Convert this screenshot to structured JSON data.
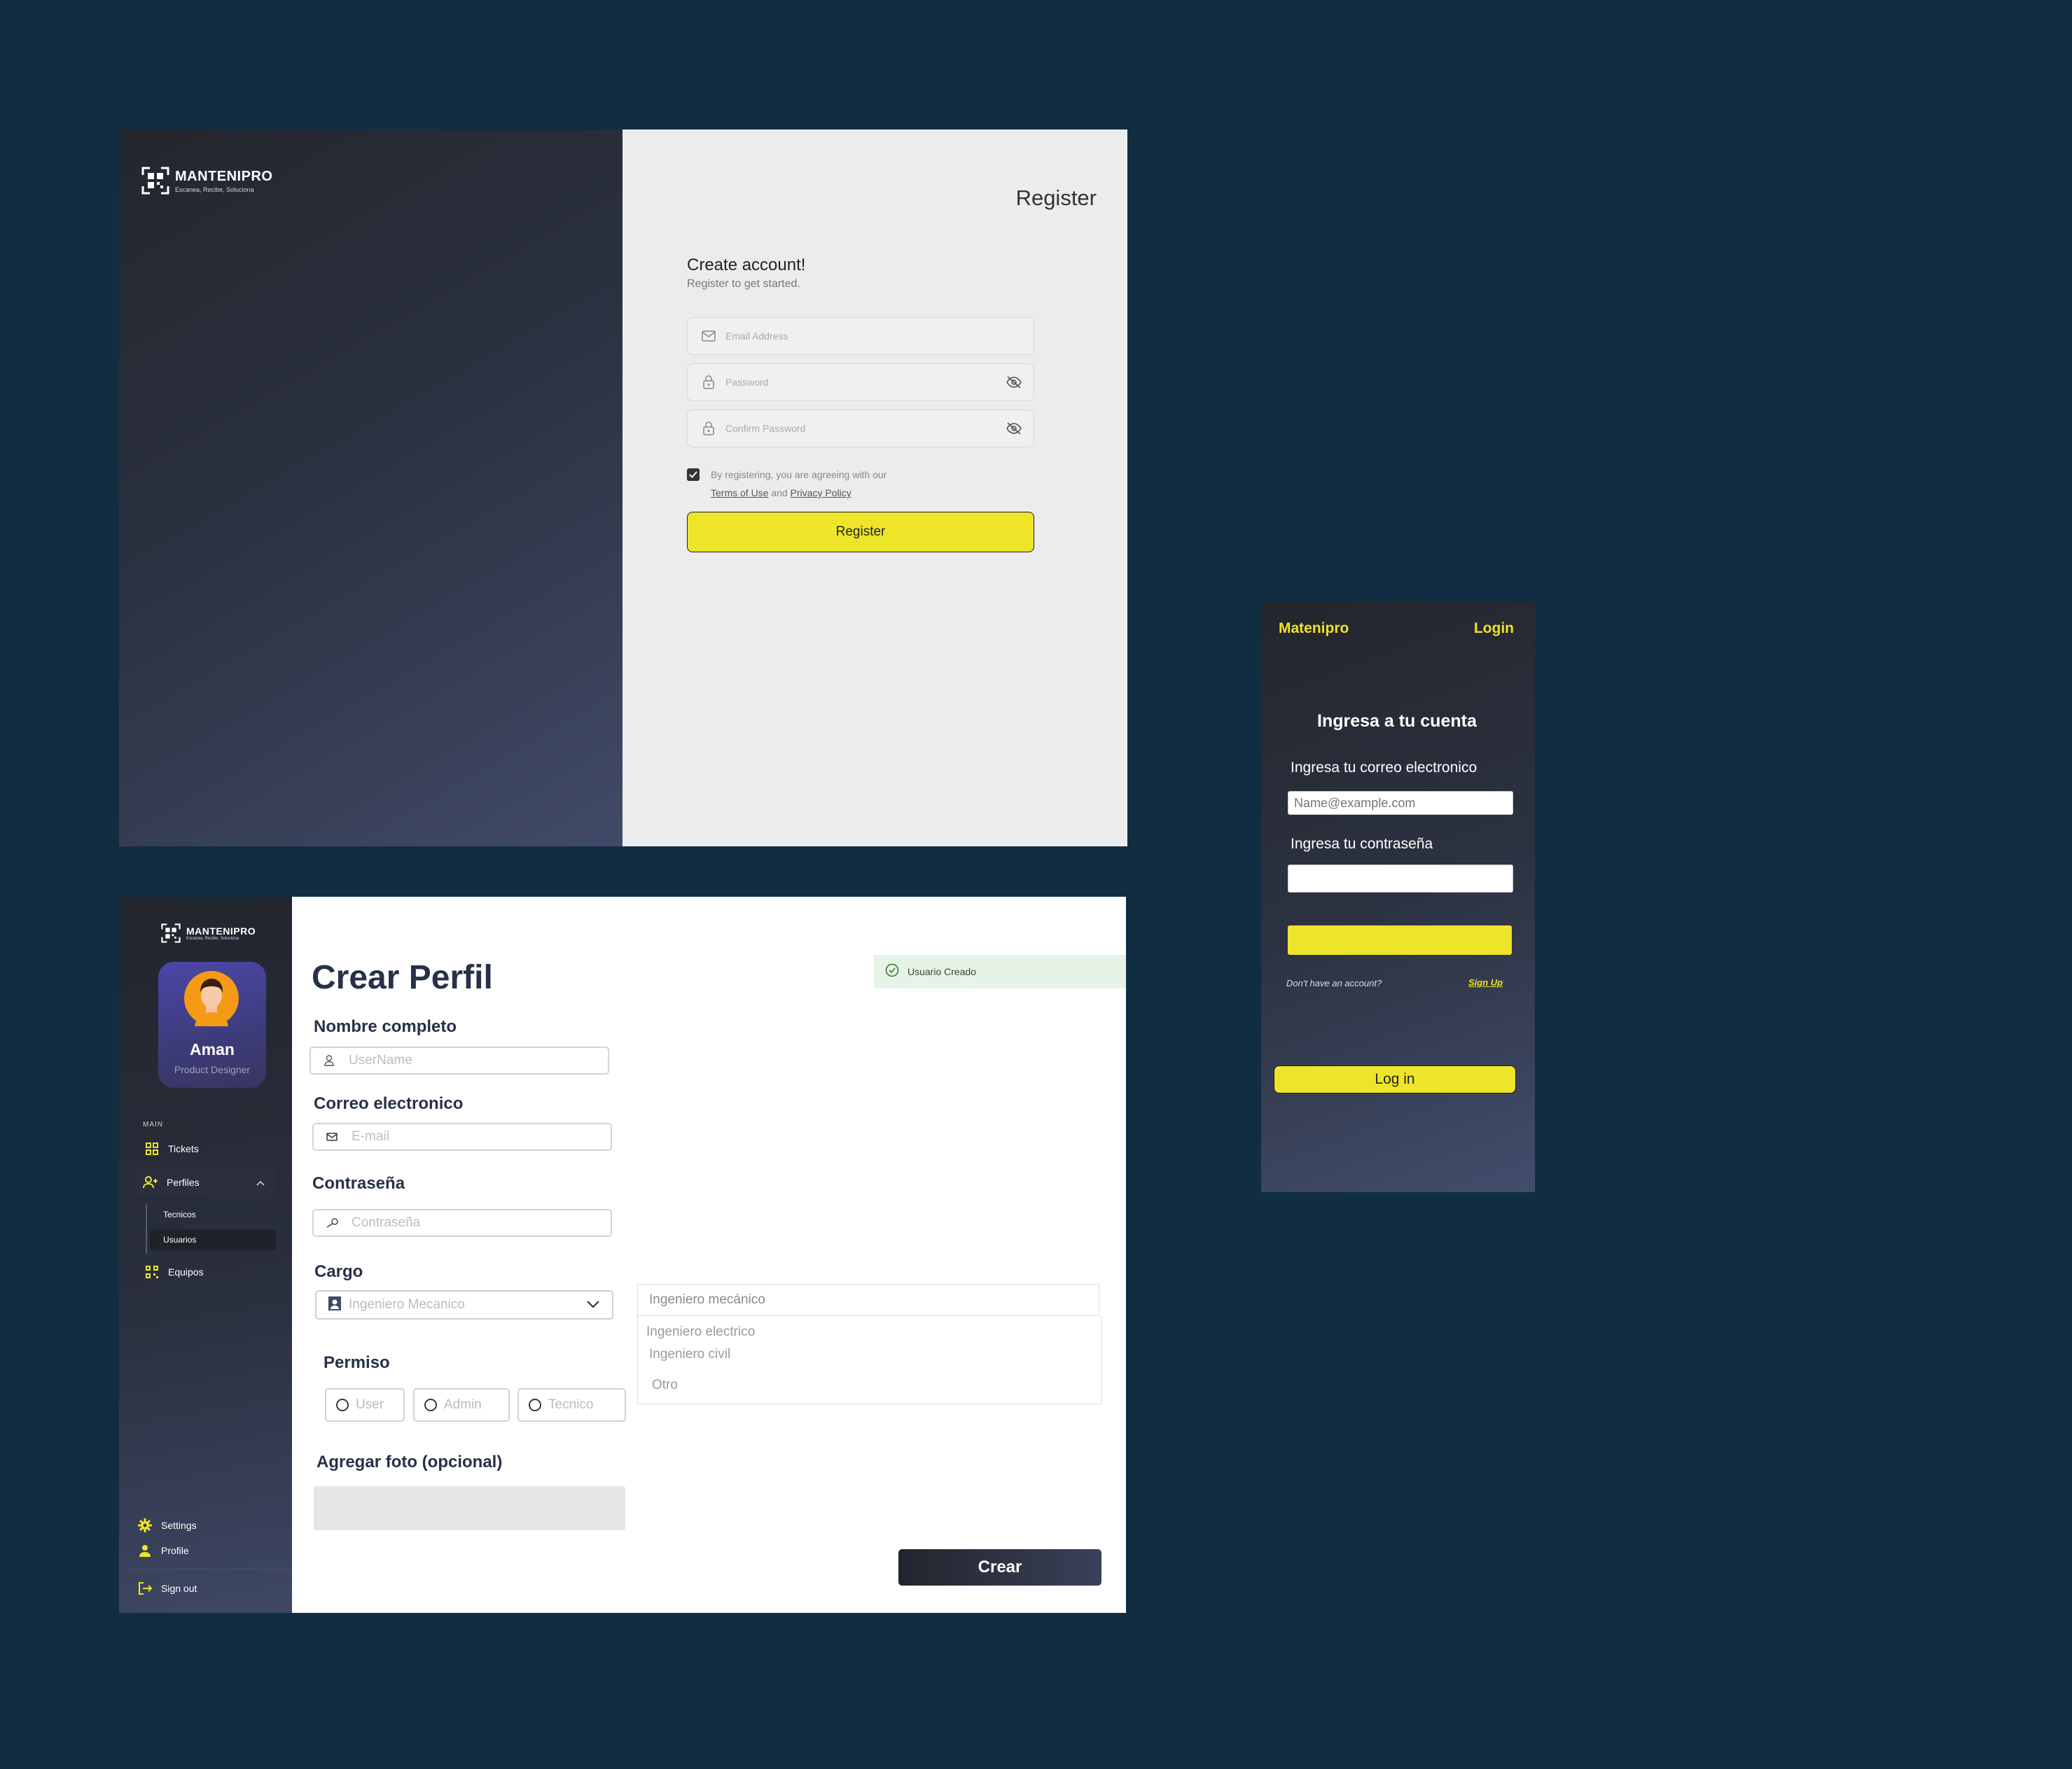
{
  "register": {
    "logo_text": "MANTENIPRO",
    "logo_tagline": "Escanea, Recibe, Soluciona",
    "heading": "Register",
    "title": "Create account!",
    "subtitle": "Register to get started.",
    "email_placeholder": "Email Address",
    "password_placeholder": "Password",
    "confirm_placeholder": "Confirm Password",
    "terms_prefix": "By registering, you are agreeing with our",
    "terms_link": "Terms of Use",
    "terms_and": "and",
    "privacy_link": "Privacy Policy",
    "button_label": "Register",
    "terms_checked": true
  },
  "mobile": {
    "brand": "Matenipro",
    "login_link": "Login",
    "title": "Ingresa a tu cuenta",
    "email_label": "Ingresa tu correo electronico",
    "email_placeholder": "Name@example.com",
    "password_label": "Ingresa tu contraseña",
    "no_account": "Don't have an account?",
    "signup": "Sign Up",
    "login_button": "Log in"
  },
  "profile": {
    "sidebar": {
      "logo_text": "MANTENIPRO",
      "logo_tagline": "Escanea, Recibe, Soluciona",
      "user_name": "Aman",
      "user_role": "Product Designer",
      "main_label": "MAIN",
      "items": {
        "tickets": "Tickets",
        "perfiles": "Perfiles",
        "tecnicos": "Tecnicos",
        "usuarios": "Usuarios",
        "equipos": "Equipos",
        "settings": "Settings",
        "profile": "Profile",
        "signout": "Sign out"
      }
    },
    "title": "Crear Perfil",
    "toast": "Usuario Creado",
    "labels": {
      "nombre": "Nombre completo",
      "correo": "Correo electronico",
      "contrasena": "Contraseña",
      "cargo": "Cargo",
      "permiso": "Permiso",
      "foto": "Agregar foto (opcional)"
    },
    "placeholders": {
      "username": "UserName",
      "email": "E-mail",
      "password": "Contraseña"
    },
    "cargo_selected": "Ingeniero Mecanico",
    "dropdown": {
      "head": "Ingeniero mecánico",
      "options": [
        "Ingeniero electrico",
        "Ingeniero civil",
        "Otro"
      ]
    },
    "permisos": [
      "User",
      "Admin",
      "Tecnico"
    ],
    "create_button": "Crear"
  },
  "colors": {
    "background": "#112d42",
    "accent_yellow": "#eee52a",
    "navy_text": "#273148"
  }
}
